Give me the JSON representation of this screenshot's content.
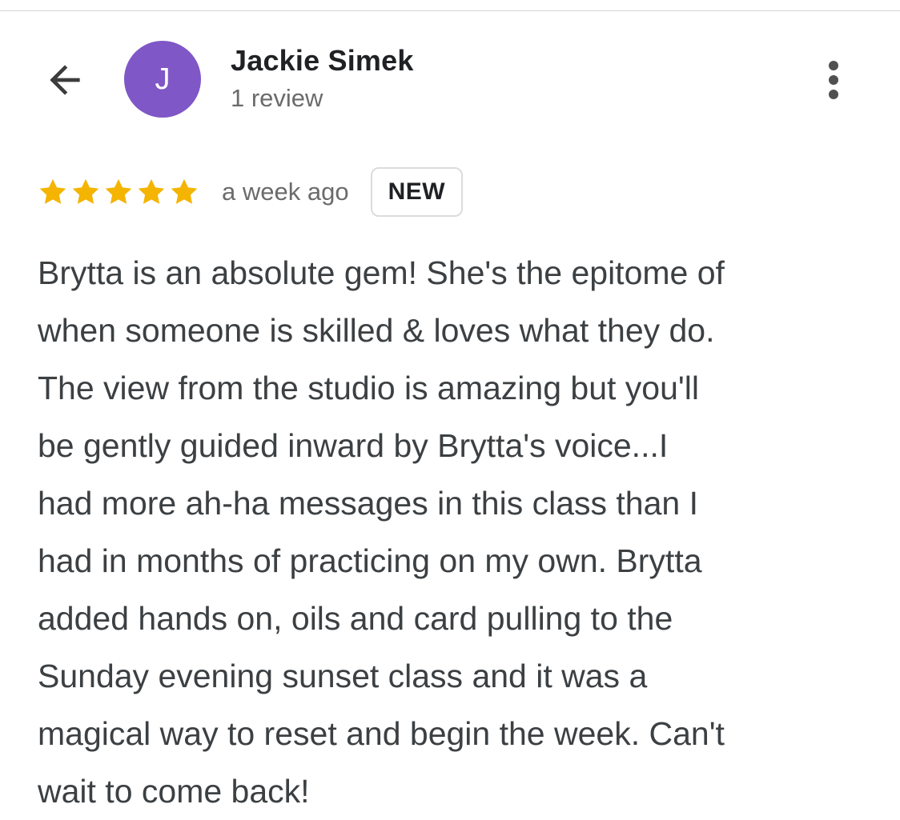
{
  "header": {
    "reviewer_name": "Jackie Simek",
    "review_count": "1 review",
    "avatar_initial": "J",
    "avatar_color": "#7f57c6",
    "back_icon": "arrow-left-icon",
    "menu_icon": "more-vert-icon"
  },
  "review": {
    "rating": 5,
    "max_rating": 5,
    "star_color": "#f4b400",
    "timestamp": "a week ago",
    "badge": "NEW",
    "text": "Brytta is an absolute gem! She's the epitome of\nwhen someone is skilled & loves what they do.\nThe view from the studio is amazing but you'll\nbe gently guided inward by Brytta's voice...I\nhad more ah-ha messages in this class than I\nhad in months of practicing on my own. Brytta\nadded hands on, oils and card pulling to the\nSunday evening sunset class and it was a\nmagical way to reset and begin the week. Can't\nwait to come back!"
  }
}
